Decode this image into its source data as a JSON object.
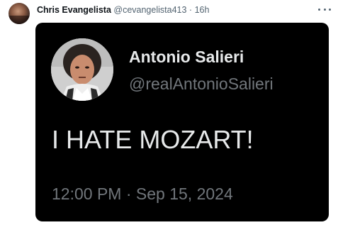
{
  "tweet": {
    "author_name": "Chris Evangelista",
    "author_handle": "@cevangelista413",
    "separator": "·",
    "time_ago": "16h",
    "more_icon": "more-horizontal-icon"
  },
  "card": {
    "background": "#000000",
    "name": "Antonio Salieri",
    "handle": "@realAntonioSalieri",
    "text": "I HATE MOZART!",
    "timestamp": "12:00 PM · Sep 15, 2024"
  },
  "colors": {
    "primary_text": "#0f1419",
    "secondary_text": "#536471",
    "card_text": "#e7e9ea",
    "card_secondary": "#71767b"
  }
}
